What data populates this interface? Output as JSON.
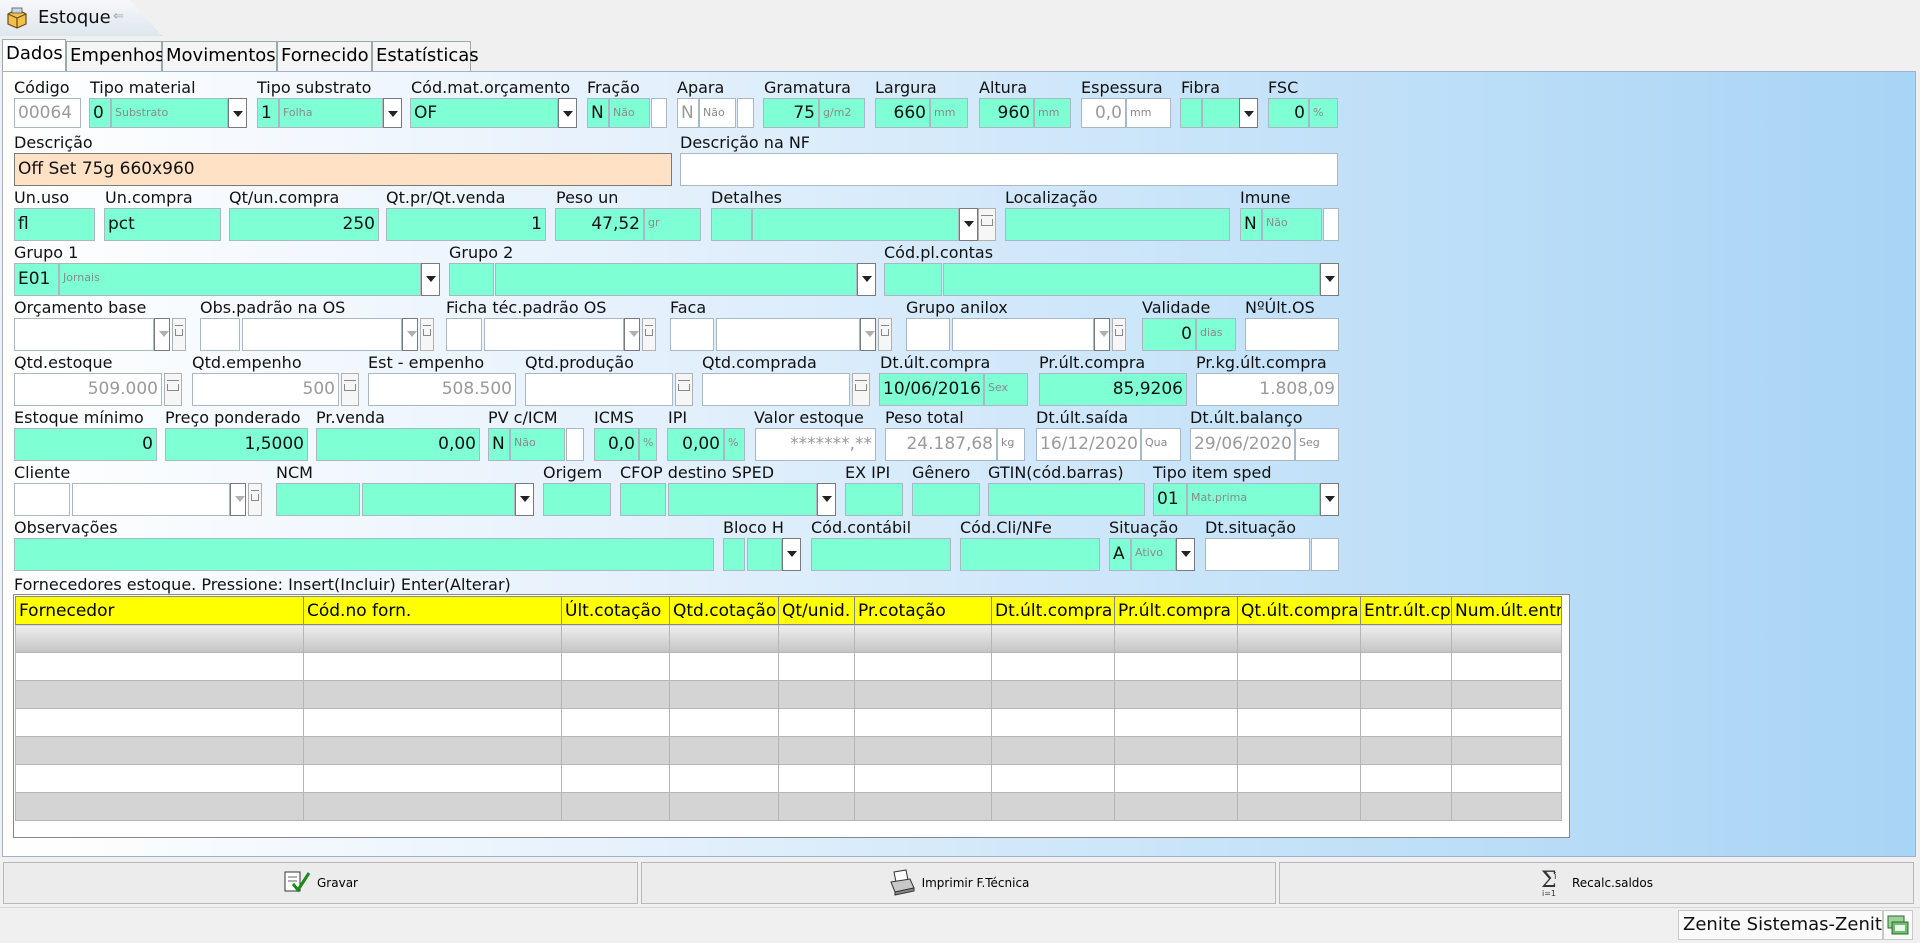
{
  "window": {
    "title": "Estoque",
    "back_glyph": "⇐",
    "icon": "package-icon"
  },
  "tabs": [
    "Dados",
    "Empenhos",
    "Movimentos",
    "Fornecido",
    "Estatísticas"
  ],
  "labels": {
    "codigo": "Código",
    "tipo_material": "Tipo material",
    "tipo_substrato": "Tipo substrato",
    "cod_mat_orc": "Cód.mat.orçamento",
    "fracao": "Fração",
    "apara": "Apara",
    "gramatura": "Gramatura",
    "largura": "Largura",
    "altura": "Altura",
    "espessura": "Espessura",
    "fibra": "Fibra",
    "fsc": "FSC",
    "descricao": "Descrição",
    "descricao_nf": "Descrição na NF",
    "un_uso": "Un.uso",
    "un_compra": "Un.compra",
    "qt_un_compra": "Qt/un.compra",
    "qt_pr_qt_venda": "Qt.pr/Qt.venda",
    "peso_un": "Peso un",
    "detalhes": "Detalhes",
    "localizacao": "Localização",
    "imune": "Imune",
    "grupo1": "Grupo 1",
    "grupo2": "Grupo 2",
    "cod_pl_contas": "Cód.pl.contas",
    "orcamento_base": "Orçamento base",
    "obs_padrao_os": "Obs.padrão na OS",
    "ficha_tec": "Ficha téc.padrão OS",
    "faca": "Faca",
    "grupo_anilox": "Grupo anilox",
    "validade": "Validade",
    "num_ult_os": "NºÚlt.OS",
    "qtd_estoque": "Qtd.estoque",
    "qtd_empenho": "Qtd.empenho",
    "est_empenho": "Est - empenho",
    "qtd_producao": "Qtd.produção",
    "qtd_comprada": "Qtd.comprada",
    "dt_ult_compra": "Dt.últ.compra",
    "pr_ult_compra": "Pr.últ.compra",
    "pr_kg_ult_compra": "Pr.kg.últ.compra",
    "estoque_minimo": "Estoque mínimo",
    "preco_ponderado": "Preço ponderado",
    "pr_venda": "Pr.venda",
    "pv_icm": "PV c/ICM",
    "icms": "ICMS",
    "ipi": "IPI",
    "valor_estoque": "Valor estoque",
    "peso_total": "Peso total",
    "dt_ult_saida": "Dt.últ.saída",
    "dt_ult_balanco": "Dt.últ.balanço",
    "cliente": "Cliente",
    "ncm": "NCM",
    "origem": "Origem",
    "cfop": "CFOP destino SPED",
    "ex_ipi": "EX IPI",
    "genero": "Gênero",
    "gtin": "GTIN(cód.barras)",
    "tipo_item_sped": "Tipo item sped",
    "observacoes": "Observações",
    "bloco_h": "Bloco H",
    "cod_contabil": "Cód.contábil",
    "cod_cli_nfe": "Cód.Cli/NFe",
    "situacao": "Situação",
    "dt_situacao": "Dt.situação"
  },
  "fields": {
    "codigo": "00064",
    "tipo_material_code": "0",
    "tipo_material_name": "Substrato",
    "tipo_substrato_code": "1",
    "tipo_substrato_name": "Folha",
    "cod_mat_orc": "OF",
    "fracao_code": "N",
    "fracao_name": "Não",
    "apara_code": "N",
    "apara_name": "Não",
    "gramatura": "75",
    "gramatura_unit": "g/m2",
    "largura": "660",
    "largura_unit": "mm",
    "altura": "960",
    "altura_unit": "mm",
    "espessura": "0,0",
    "espessura_unit": "mm",
    "fsc": "0",
    "fsc_unit": "%",
    "descricao": "Off Set  75g 660x960",
    "un_uso": "fl",
    "un_compra": "pct",
    "qt_un_compra": "250",
    "qt_pr_qt_venda": "1",
    "peso_un": "47,52",
    "peso_un_unit": "gr",
    "imune_code": "N",
    "imune_name": "Não",
    "grupo1_code": "E01",
    "grupo1_name": "Jornais",
    "validade": "0",
    "validade_unit": "dias",
    "qtd_estoque": "509.000",
    "qtd_empenho": "500",
    "est_empenho": "508.500",
    "dt_ult_compra": "10/06/2016",
    "dt_ult_compra_dow": "Sex",
    "pr_ult_compra": "85,9206",
    "pr_kg_ult_compra": "1.808,09",
    "estoque_minimo": "0",
    "preco_ponderado": "1,5000",
    "pr_venda": "0,00",
    "pv_icm_code": "N",
    "pv_icm_name": "Não",
    "icms": "0,0",
    "icms_unit": "%",
    "ipi": "0,00",
    "ipi_unit": "%",
    "valor_estoque": "*******,**",
    "peso_total": "24.187,68",
    "peso_total_unit": "kg",
    "dt_ult_saida": "16/12/2020",
    "dt_ult_saida_dow": "Qua",
    "dt_ult_balanco": "29/06/2020",
    "dt_ult_balanco_dow": "Seg",
    "tipo_item_sped_code": "01",
    "tipo_item_sped_name": "Mat.prima",
    "situacao_code": "A",
    "situacao_name": "Ativo"
  },
  "suppliers": {
    "caption": "Fornecedores estoque.  Pressione: Insert(Incluir) Enter(Alterar)",
    "columns": [
      "Fornecedor",
      "Cód.no forn.",
      "Últ.cotação",
      "Qtd.cotação",
      "Qt/unid.",
      "Pr.cotação",
      "Dt.últ.compra",
      "Pr.últ.compra",
      "Qt.últ.compra",
      "Entr.últ.cp",
      "Num.últ.entr"
    ]
  },
  "buttons": {
    "gravar": "Gravar",
    "imprimir": "Imprimir F.Técnica",
    "recalc": "Recalc.saldos"
  },
  "status": {
    "company": "Zenite Sistemas-Zenite"
  },
  "colors": {
    "field_bg": "#7fffd4",
    "panel_bg": "#a8d4f5",
    "header_yellow": "#ffff00",
    "desc_bg": "#ffe2c6"
  }
}
